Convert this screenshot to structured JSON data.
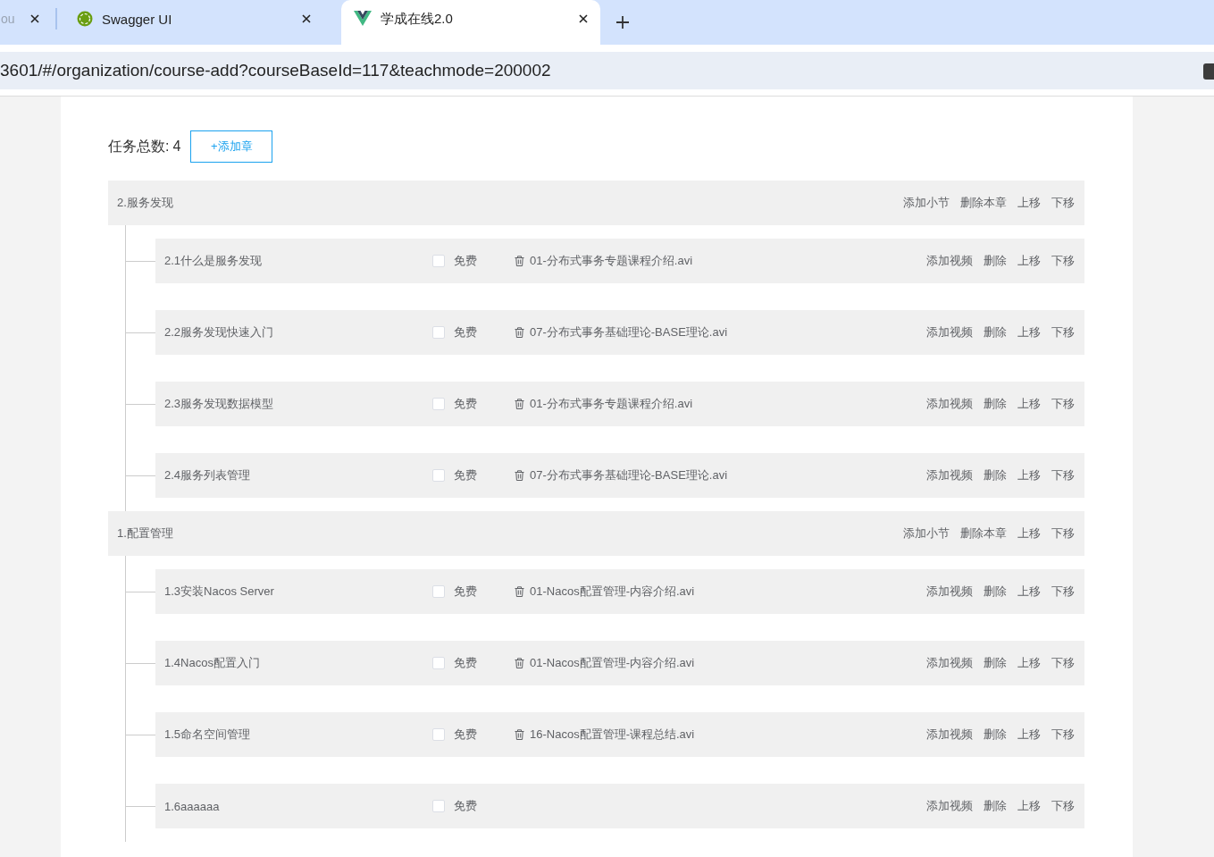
{
  "browser": {
    "tabs": [
      {
        "title": "ou",
        "kind": "plain",
        "selected": false
      },
      {
        "title": "Swagger UI",
        "kind": "api-docs",
        "selected": false
      },
      {
        "title": "学成在线2.0",
        "kind": "app",
        "selected": true
      }
    ],
    "address": "3601/#/organization/course-add?courseBaseId=117&teachmode=200002"
  },
  "page": {
    "task_total_label": "任务总数:",
    "task_total": "4",
    "add_chapter_button": "+添加章",
    "chapters": [
      {
        "title": "2.服务发现",
        "actions": [
          "添加小节",
          "删除本章",
          "上移",
          "下移"
        ],
        "sections": [
          {
            "title": "2.1什么是服务发现",
            "free": {
              "label": "免费",
              "checked": false
            },
            "video": "01-分布式事务专题课程介绍.avi",
            "actions": [
              "添加视频",
              "删除",
              "上移",
              "下移"
            ]
          },
          {
            "title": "2.2服务发现快速入门",
            "free": {
              "label": "免费",
              "checked": false
            },
            "video": "07-分布式事务基础理论-BASE理论.avi",
            "actions": [
              "添加视频",
              "删除",
              "上移",
              "下移"
            ]
          },
          {
            "title": "2.3服务发现数据模型",
            "free": {
              "label": "免费",
              "checked": false
            },
            "video": "01-分布式事务专题课程介绍.avi",
            "actions": [
              "添加视频",
              "删除",
              "上移",
              "下移"
            ]
          },
          {
            "title": "2.4服务列表管理",
            "free": {
              "label": "免费",
              "checked": false
            },
            "video": "07-分布式事务基础理论-BASE理论.avi",
            "actions": [
              "添加视频",
              "删除",
              "上移",
              "下移"
            ]
          }
        ]
      },
      {
        "title": "1.配置管理",
        "actions": [
          "添加小节",
          "删除本章",
          "上移",
          "下移"
        ],
        "sections": [
          {
            "title": "1.3安装Nacos Server",
            "free": {
              "label": "免费",
              "checked": false
            },
            "video": "01-Nacos配置管理-内容介绍.avi",
            "actions": [
              "添加视频",
              "删除",
              "上移",
              "下移"
            ]
          },
          {
            "title": "1.4Nacos配置入门",
            "free": {
              "label": "免费",
              "checked": false
            },
            "video": "01-Nacos配置管理-内容介绍.avi",
            "actions": [
              "添加视频",
              "删除",
              "上移",
              "下移"
            ]
          },
          {
            "title": "1.5命名空间管理",
            "free": {
              "label": "免费",
              "checked": false
            },
            "video": "16-Nacos配置管理-课程总结.avi",
            "actions": [
              "添加视频",
              "删除",
              "上移",
              "下移"
            ]
          },
          {
            "title": "1.6aaaaaa",
            "free": {
              "label": "免费",
              "checked": false
            },
            "actions": [
              "添加视频",
              "删除",
              "上移",
              "下移"
            ]
          }
        ]
      }
    ]
  }
}
